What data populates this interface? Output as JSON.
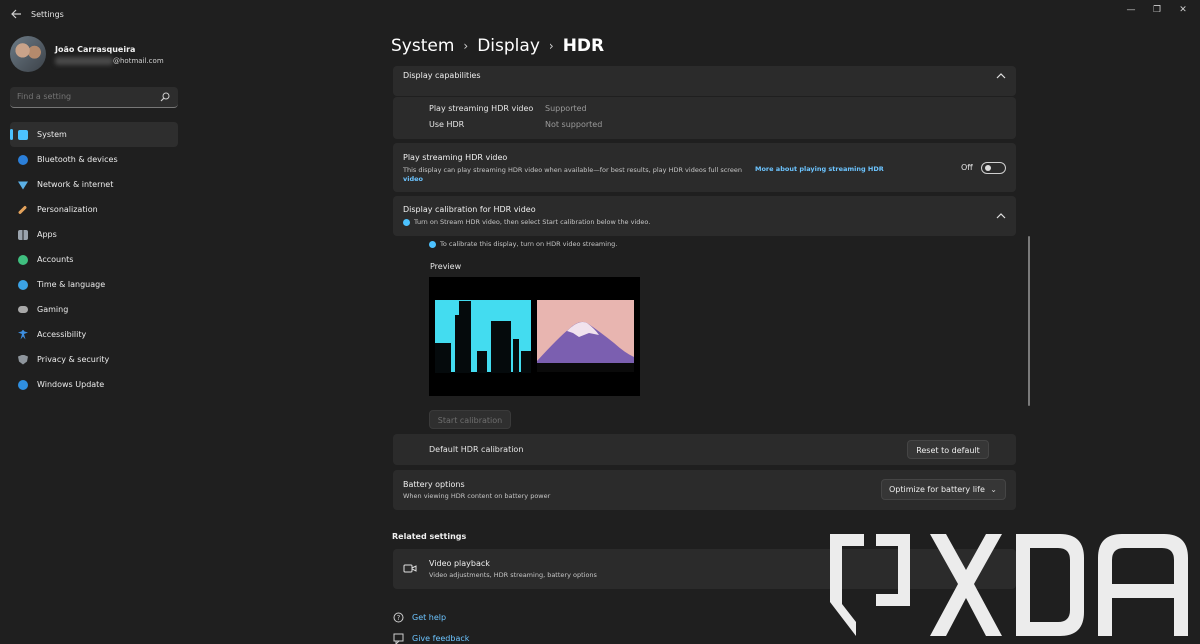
{
  "app": {
    "title": "Settings"
  },
  "profile": {
    "name": "João Carrasqueira",
    "email": "@hotmail.com"
  },
  "search": {
    "placeholder": "Find a setting"
  },
  "sidebar": {
    "items": [
      {
        "label": "System",
        "icon": "monitor-icon",
        "color": "#4cc2ff"
      },
      {
        "label": "Bluetooth & devices",
        "icon": "bluetooth-icon",
        "color": "#2b7fd9"
      },
      {
        "label": "Network & internet",
        "icon": "wifi-icon",
        "color": "#5bb0e6"
      },
      {
        "label": "Personalization",
        "icon": "brush-icon",
        "color": "#e3a25b"
      },
      {
        "label": "Apps",
        "icon": "apps-icon",
        "color": "#9aa3ad"
      },
      {
        "label": "Accounts",
        "icon": "person-icon",
        "color": "#3fbf7f"
      },
      {
        "label": "Time & language",
        "icon": "globe-icon",
        "color": "#3ba3e6"
      },
      {
        "label": "Gaming",
        "icon": "gamepad-icon",
        "color": "#a8a8a8"
      },
      {
        "label": "Accessibility",
        "icon": "accessibility-icon",
        "color": "#3d8ee0"
      },
      {
        "label": "Privacy & security",
        "icon": "shield-icon",
        "color": "#8e959c"
      },
      {
        "label": "Windows Update",
        "icon": "update-icon",
        "color": "#2f8fe0"
      }
    ]
  },
  "breadcrumb": {
    "part1": "System",
    "part2": "Display",
    "current": "HDR"
  },
  "capabilities": {
    "title": "Display capabilities",
    "rows": [
      {
        "label": "Play streaming HDR video",
        "value": "Supported"
      },
      {
        "label": "Use HDR",
        "value": "Not supported"
      }
    ]
  },
  "streaming": {
    "title": "Play streaming HDR video",
    "desc": "This display can play streaming HDR video when available—for best results, play HDR videos full screen",
    "link": "More about playing streaming HDR",
    "link2": "video",
    "toggle_label": "Off",
    "toggle_on": false
  },
  "calibration": {
    "title": "Display calibration for HDR video",
    "subtitle": "Turn on Stream HDR video, then select Start calibration below the video.",
    "info": "To calibrate this display, turn on HDR video streaming.",
    "preview_label": "Preview",
    "start_button": "Start calibration"
  },
  "default_calibration": {
    "label": "Default HDR calibration",
    "reset_button": "Reset to default"
  },
  "battery": {
    "title": "Battery options",
    "subtitle": "When viewing HDR content on battery power",
    "selected": "Optimize for battery life"
  },
  "related": {
    "title": "Related settings",
    "video_playback": {
      "title": "Video playback",
      "subtitle": "Video adjustments, HDR streaming, battery options"
    }
  },
  "help": {
    "get_help": "Get help",
    "give_feedback": "Give feedback"
  },
  "watermark": {
    "text": "XDA"
  },
  "colors": {
    "accent": "#4cc2ff",
    "background": "#1f1f1f",
    "card": "#2b2b2b",
    "link": "#6cc4ff"
  }
}
